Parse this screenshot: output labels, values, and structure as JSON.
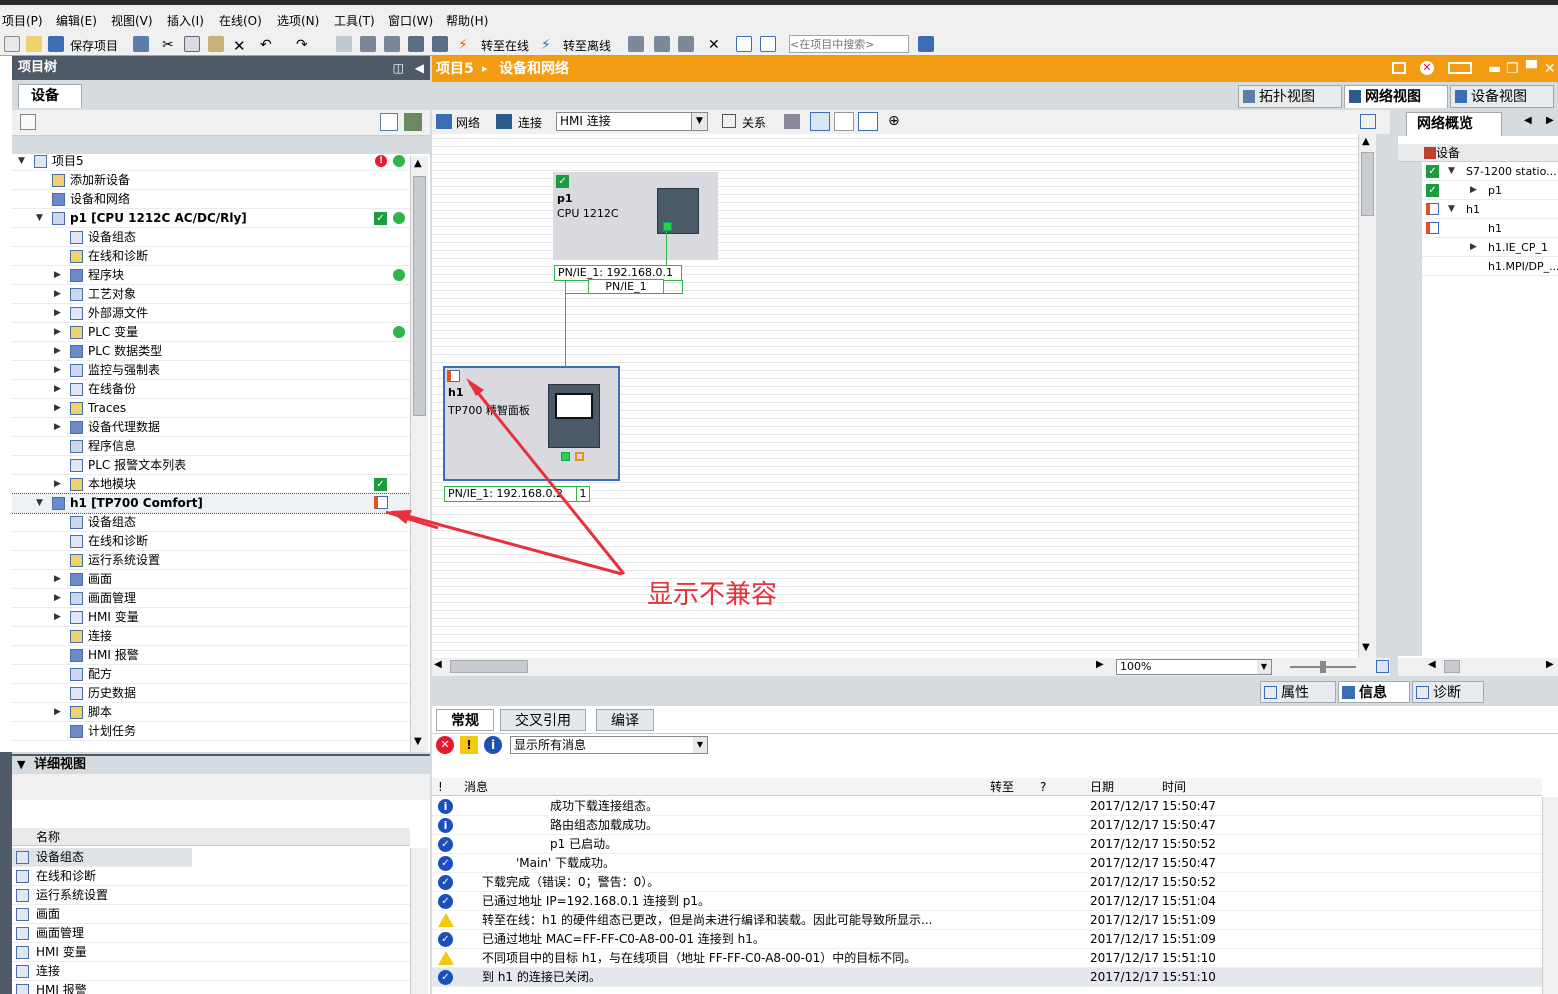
{
  "menu": [
    "项目(P)",
    "编辑(E)",
    "视图(V)",
    "插入(I)",
    "在线(O)",
    "选项(N)",
    "工具(T)",
    "窗口(W)",
    "帮助(H)"
  ],
  "toolbar": {
    "save": "保存项目",
    "go_online": "转至在线",
    "go_offline": "转至离线",
    "search_placeholder": "<在项目中搜索>"
  },
  "project_tree": {
    "title": "项目树",
    "tab": "设备",
    "items": [
      {
        "label": "项目5",
        "level": 0,
        "arrow": "▼"
      },
      {
        "label": "添加新设备",
        "level": 1,
        "arrow": ""
      },
      {
        "label": "设备和网络",
        "level": 1,
        "arrow": ""
      },
      {
        "label": "p1 [CPU 1212C AC/DC/Rly]",
        "level": 1,
        "arrow": "▼"
      },
      {
        "label": "设备组态",
        "level": 2,
        "arrow": ""
      },
      {
        "label": "在线和诊断",
        "level": 2,
        "arrow": ""
      },
      {
        "label": "程序块",
        "level": 2,
        "arrow": "▶"
      },
      {
        "label": "工艺对象",
        "level": 2,
        "arrow": "▶"
      },
      {
        "label": "外部源文件",
        "level": 2,
        "arrow": "▶"
      },
      {
        "label": "PLC 变量",
        "level": 2,
        "arrow": "▶"
      },
      {
        "label": "PLC 数据类型",
        "level": 2,
        "arrow": "▶"
      },
      {
        "label": "监控与强制表",
        "level": 2,
        "arrow": "▶"
      },
      {
        "label": "在线备份",
        "level": 2,
        "arrow": "▶"
      },
      {
        "label": "Traces",
        "level": 2,
        "arrow": "▶"
      },
      {
        "label": "设备代理数据",
        "level": 2,
        "arrow": "▶"
      },
      {
        "label": "程序信息",
        "level": 2,
        "arrow": ""
      },
      {
        "label": "PLC 报警文本列表",
        "level": 2,
        "arrow": ""
      },
      {
        "label": "本地模块",
        "level": 2,
        "arrow": "▶"
      },
      {
        "label": "h1 [TP700 Comfort]",
        "level": 1,
        "arrow": "▼"
      },
      {
        "label": "设备组态",
        "level": 2,
        "arrow": ""
      },
      {
        "label": "在线和诊断",
        "level": 2,
        "arrow": ""
      },
      {
        "label": "运行系统设置",
        "level": 2,
        "arrow": ""
      },
      {
        "label": "画面",
        "level": 2,
        "arrow": "▶"
      },
      {
        "label": "画面管理",
        "level": 2,
        "arrow": "▶"
      },
      {
        "label": "HMI 变量",
        "level": 2,
        "arrow": "▶"
      },
      {
        "label": "连接",
        "level": 2,
        "arrow": ""
      },
      {
        "label": "HMI 报警",
        "level": 2,
        "arrow": ""
      },
      {
        "label": "配方",
        "level": 2,
        "arrow": ""
      },
      {
        "label": "历史数据",
        "level": 2,
        "arrow": ""
      },
      {
        "label": "脚本",
        "level": 2,
        "arrow": "▶"
      },
      {
        "label": "计划任务",
        "level": 2,
        "arrow": ""
      }
    ]
  },
  "detail_view": {
    "title": "详细视图",
    "col_name": "名称",
    "items": [
      "设备组态",
      "在线和诊断",
      "运行系统设置",
      "画面",
      "画面管理",
      "HMI 变量",
      "连接",
      "HMI 报警"
    ]
  },
  "editor": {
    "breadcrumb_project": "项目5",
    "breadcrumb_sep": "▸",
    "breadcrumb_page": "设备和网络",
    "tabs": [
      "拓扑视图",
      "网络视图",
      "设备视图"
    ],
    "netbar": {
      "network": "网络",
      "connect": "连接",
      "connection_type": "HMI 连接",
      "relations": "关系"
    },
    "zoom": "100%",
    "devices": {
      "p1": {
        "name": "p1",
        "type": "CPU 1212C",
        "port_label": "PN/IE_1: 192.168.0.1"
      },
      "subnet": "PN/IE_1",
      "h1": {
        "name": "h1",
        "type": "TP700 精智面板",
        "port_label": "PN/IE_1: 192.168.0.2",
        "port_suffix": "1"
      }
    },
    "annotation": "显示不兼容"
  },
  "overview": {
    "title": "网络概览",
    "col": "设备",
    "items": [
      "S7-1200 statio...",
      "p1",
      "h1",
      "h1",
      "h1.IE_CP_1",
      "h1.MPI/DP_..."
    ]
  },
  "inspector": {
    "tabs": [
      "属性",
      "信息",
      "诊断"
    ],
    "subtabs": [
      "常规",
      "交叉引用",
      "编译"
    ],
    "filter": "显示所有消息",
    "columns": {
      "flag": "!",
      "message": "消息",
      "goto": "转至",
      "q": "?",
      "date": "日期",
      "time": "时间"
    },
    "messages": [
      {
        "type": "info",
        "text": "成功下载连接组态。",
        "indent": 2,
        "date": "2017/12/17",
        "time": "15:50:47"
      },
      {
        "type": "info",
        "text": "路由组态加载成功。",
        "indent": 2,
        "date": "2017/12/17",
        "time": "15:50:47"
      },
      {
        "type": "ok",
        "text": "p1 已启动。",
        "indent": 2,
        "date": "2017/12/17",
        "time": "15:50:52"
      },
      {
        "type": "ok",
        "text": "'Main' 下载成功。",
        "indent": 1,
        "date": "2017/12/17",
        "time": "15:50:47"
      },
      {
        "type": "ok",
        "text": "下载完成（错误：0；警告：0）。",
        "indent": 0,
        "date": "2017/12/17",
        "time": "15:50:52"
      },
      {
        "type": "ok",
        "text": "已通过地址 IP=192.168.0.1 连接到 p1。",
        "indent": 0,
        "date": "2017/12/17",
        "time": "15:51:04"
      },
      {
        "type": "warn",
        "text": "转至在线：h1 的硬件组态已更改，但是尚未进行编译和装载。因此可能导致所显示...",
        "indent": 0,
        "date": "2017/12/17",
        "time": "15:51:09"
      },
      {
        "type": "ok",
        "text": "已通过地址 MAC=FF-FF-C0-A8-00-01 连接到 h1。",
        "indent": 0,
        "date": "2017/12/17",
        "time": "15:51:09"
      },
      {
        "type": "warn",
        "text": "不同项目中的目标 h1，与在线项目（地址 FF-FF-C0-A8-00-01）中的目标不同。",
        "indent": 0,
        "date": "2017/12/17",
        "time": "15:51:10"
      },
      {
        "type": "ok",
        "text": "到 h1 的连接已关闭。",
        "indent": 0,
        "date": "2017/12/17",
        "time": "15:51:10"
      }
    ]
  },
  "colors": {
    "accent": "#f39c12",
    "panel_header": "#4e5b66",
    "ok": "#2fb54a",
    "error": "#e8192c",
    "link": "#2fb54a",
    "annotation": "#e8303a"
  }
}
